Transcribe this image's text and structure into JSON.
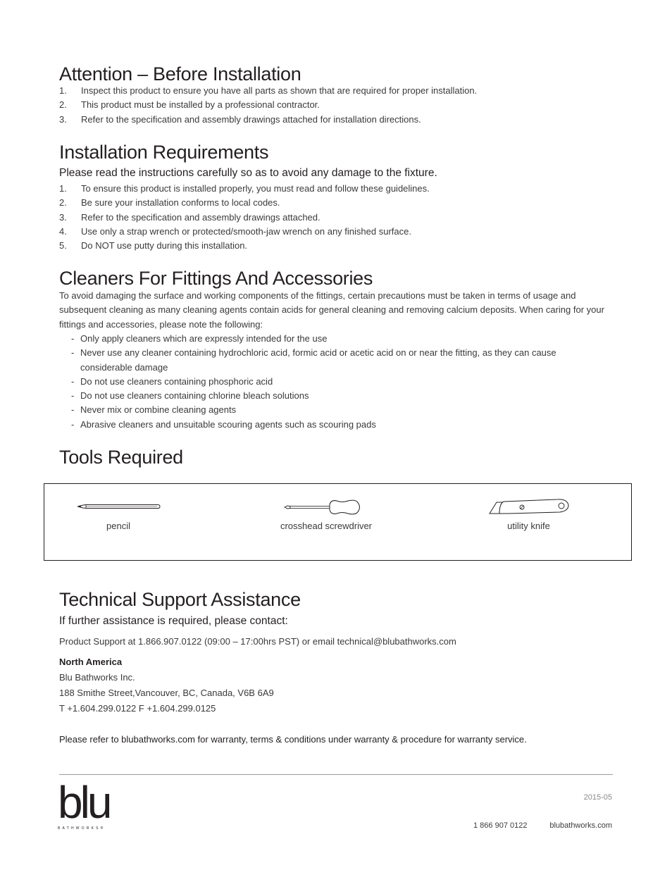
{
  "sections": {
    "attention": {
      "title": "Attention – Before Installation",
      "items": [
        {
          "num": "1.",
          "text": "Inspect this product to ensure you have all parts as shown that are required for proper installation."
        },
        {
          "num": "2.",
          "text": "This product must be installed by a professional contractor."
        },
        {
          "num": "3.",
          "text": "Refer to the specification and assembly drawings attached for installation directions."
        }
      ]
    },
    "requirements": {
      "title": "Installation Requirements",
      "subtitle": "Please read the instructions carefully so as to avoid any damage to the fixture.",
      "items": [
        {
          "num": "1.",
          "text": "To ensure this product is installed properly, you must read and follow these guidelines."
        },
        {
          "num": "2.",
          "text": "Be sure your installation conforms to local codes."
        },
        {
          "num": "3.",
          "text": "Refer to the specification and assembly drawings attached."
        },
        {
          "num": "4.",
          "text": "Use only a strap wrench or protected/smooth-jaw wrench on any finished surface."
        },
        {
          "num": "5.",
          "text": "Do NOT use putty during this installation."
        }
      ]
    },
    "cleaners": {
      "title": "Cleaners For Fittings And Accessories",
      "intro": "To avoid damaging the surface and working components of the fittings, certain precautions must be taken in terms of usage and subsequent cleaning as many cleaning agents contain acids for general cleaning and removing calcium deposits. When caring for your fittings and accessories, please note the following:",
      "bullet": "-",
      "items": [
        "Only apply cleaners which are expressly intended for the use",
        "Never use any cleaner containing hydrochloric acid, formic acid or acetic acid on or near the fitting, as they can cause considerable damage",
        "Do not use cleaners containing phosphoric acid",
        "Do not use cleaners containing chlorine bleach solutions",
        "Never mix or combine cleaning agents",
        "Abrasive cleaners and unsuitable scouring agents such as scouring pads"
      ]
    },
    "tools": {
      "title": "Tools Required",
      "items": [
        {
          "icon": "pencil-icon",
          "label": "pencil"
        },
        {
          "icon": "screwdriver-icon",
          "label": "crosshead screwdriver"
        },
        {
          "icon": "utility-knife-icon",
          "label": "utility knife"
        }
      ]
    },
    "support": {
      "title": "Technical Support Assistance",
      "subtitle": "If further assistance is required, please contact:",
      "product_support": "Product Support at 1.866.907.0122 (09:00 – 17:00hrs PST) or email technical@blubathworks.com",
      "region": "North America",
      "company": "Blu Bathworks Inc.",
      "address": "188 Smithe Street,Vancouver, BC, Canada, V6B 6A9",
      "phone_fax": "T +1.604.299.0122  F +1.604.299.0125",
      "warranty_note": "Please refer to blubathworks.com for warranty, terms & conditions under warranty & procedure for warranty service."
    }
  },
  "footer": {
    "logo_word": "blu",
    "logo_tagline": "BATHWORKS®",
    "date": "2015-05",
    "phone": "1 866 907 0122",
    "website": "blubathworks.com"
  }
}
